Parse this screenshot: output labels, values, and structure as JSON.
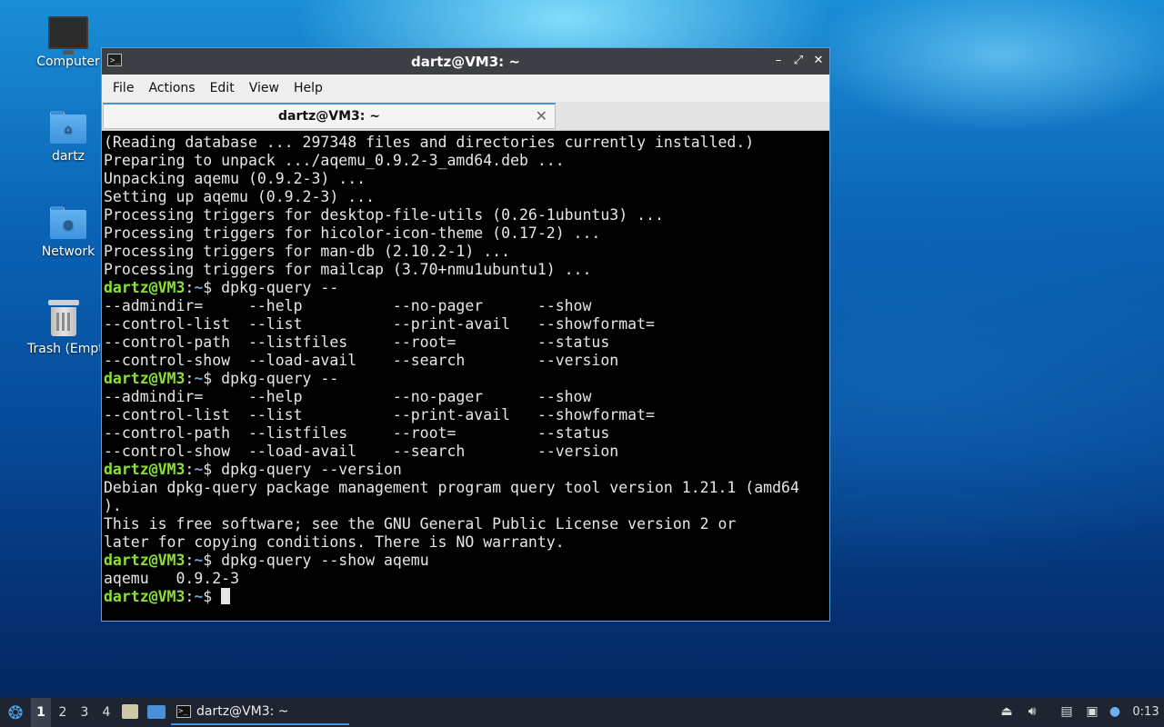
{
  "desktop": {
    "icons": [
      {
        "label": "Computer",
        "icon": "computer-icon"
      },
      {
        "label": "dartz",
        "icon": "home-folder-icon"
      },
      {
        "label": "Network",
        "icon": "network-folder-icon"
      },
      {
        "label": "Trash (Empty)",
        "icon": "trash-icon"
      }
    ]
  },
  "window": {
    "title": "dartz@VM3: ~",
    "menu": [
      "File",
      "Actions",
      "Edit",
      "View",
      "Help"
    ],
    "tab_label": "dartz@VM3: ~",
    "controls": {
      "minimize": "–",
      "maximize": "⤢",
      "close": "✕"
    }
  },
  "terminal": {
    "prompt_user": "dartz@VM3",
    "prompt_path": "~",
    "lines": [
      {
        "type": "out",
        "text": "(Reading database ... 297348 files and directories currently installed.)"
      },
      {
        "type": "out",
        "text": "Preparing to unpack .../aqemu_0.9.2-3_amd64.deb ..."
      },
      {
        "type": "out",
        "text": "Unpacking aqemu (0.9.2-3) ..."
      },
      {
        "type": "out",
        "text": "Setting up aqemu (0.9.2-3) ..."
      },
      {
        "type": "out",
        "text": "Processing triggers for desktop-file-utils (0.26-1ubuntu3) ..."
      },
      {
        "type": "out",
        "text": "Processing triggers for hicolor-icon-theme (0.17-2) ..."
      },
      {
        "type": "out",
        "text": "Processing triggers for man-db (2.10.2-1) ..."
      },
      {
        "type": "out",
        "text": "Processing triggers for mailcap (3.70+nmu1ubuntu1) ..."
      },
      {
        "type": "cmd",
        "text": " dpkg-query --"
      },
      {
        "type": "out",
        "text": "--admindir=     --help          --no-pager      --show"
      },
      {
        "type": "out",
        "text": "--control-list  --list          --print-avail   --showformat="
      },
      {
        "type": "out",
        "text": "--control-path  --listfiles     --root=         --status"
      },
      {
        "type": "out",
        "text": "--control-show  --load-avail    --search        --version"
      },
      {
        "type": "cmd",
        "text": " dpkg-query --"
      },
      {
        "type": "out",
        "text": "--admindir=     --help          --no-pager      --show"
      },
      {
        "type": "out",
        "text": "--control-list  --list          --print-avail   --showformat="
      },
      {
        "type": "out",
        "text": "--control-path  --listfiles     --root=         --status"
      },
      {
        "type": "out",
        "text": "--control-show  --load-avail    --search        --version"
      },
      {
        "type": "cmd",
        "text": " dpkg-query --version"
      },
      {
        "type": "out",
        "text": "Debian dpkg-query package management program query tool version 1.21.1 (amd64"
      },
      {
        "type": "out",
        "text": ")."
      },
      {
        "type": "out",
        "text": "This is free software; see the GNU General Public License version 2 or"
      },
      {
        "type": "out",
        "text": "later for copying conditions. There is NO warranty."
      },
      {
        "type": "cmd",
        "text": " dpkg-query --show aqemu"
      },
      {
        "type": "out",
        "text": "aqemu   0.9.2-3"
      },
      {
        "type": "cur",
        "text": " "
      }
    ]
  },
  "taskbar": {
    "workspaces": [
      "1",
      "2",
      "3",
      "4"
    ],
    "active_workspace": "1",
    "task_label": "dartz@VM3: ~",
    "clock": "0:13",
    "launcher_icons": [
      "file-manager-icon",
      "show-desktop-icon"
    ],
    "tray_icons": [
      "eject-icon",
      "volume-icon",
      "clipboard-icon",
      "network-icon",
      "update-notifier-icon"
    ]
  }
}
